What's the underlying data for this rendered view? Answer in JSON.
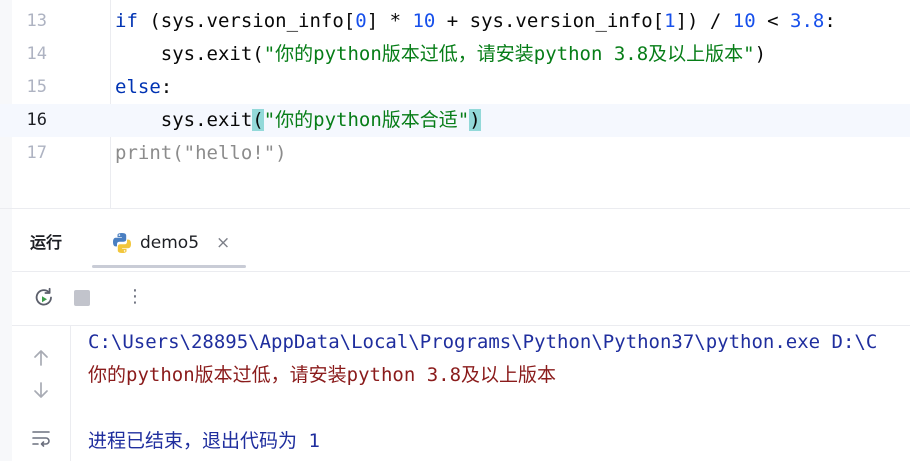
{
  "editor": {
    "lines": [
      {
        "number": "13",
        "tokens": [
          {
            "t": "if",
            "c": "kw"
          },
          {
            "t": " (sys.version_info[",
            "c": ""
          },
          {
            "t": "0",
            "c": "num"
          },
          {
            "t": "] * ",
            "c": ""
          },
          {
            "t": "10",
            "c": "num"
          },
          {
            "t": " + sys.version_info[",
            "c": ""
          },
          {
            "t": "1",
            "c": "num"
          },
          {
            "t": "]) / ",
            "c": ""
          },
          {
            "t": "10",
            "c": "num"
          },
          {
            "t": " < ",
            "c": ""
          },
          {
            "t": "3.8",
            "c": "num"
          },
          {
            "t": ":",
            "c": ""
          }
        ]
      },
      {
        "number": "14",
        "tokens": [
          {
            "t": "    sys.exit(",
            "c": ""
          },
          {
            "t": "\"你的python版本过低，请安装python 3.8及以上版本\"",
            "c": "str"
          },
          {
            "t": ")",
            "c": ""
          }
        ]
      },
      {
        "number": "15",
        "tokens": [
          {
            "t": "else",
            "c": "kw"
          },
          {
            "t": ":",
            "c": ""
          }
        ]
      },
      {
        "number": "16",
        "current": true,
        "tokens": [
          {
            "t": "    sys.exit",
            "c": ""
          },
          {
            "t": "(",
            "c": "brace"
          },
          {
            "t": "\"你的python版本合适\"",
            "c": "str"
          },
          {
            "t": ")",
            "c": "brace"
          }
        ]
      },
      {
        "number": "17",
        "tokens": [
          {
            "t": "print(\"hello!\")",
            "c": "unused"
          }
        ]
      }
    ]
  },
  "run_panel": {
    "title": "运行",
    "tab": {
      "label": "demo5",
      "close": "×",
      "icon": "python-icon"
    },
    "toolbar": {
      "rerun_icon": "rerun-icon",
      "stop_icon": "stop-icon",
      "more": "⋮"
    },
    "rail": [
      "arrow-up-icon",
      "arrow-down-icon",
      "soft-wrap-icon"
    ],
    "console": {
      "command": "C:\\Users\\28895\\AppData\\Local\\Programs\\Python\\Python37\\python.exe D:\\C",
      "error": "你的python版本过低，请安装python 3.8及以上版本",
      "blank": "",
      "exit": "进程已结束，退出代码为 1"
    }
  },
  "colors": {
    "keyword": "#0033b3",
    "number": "#1750eb",
    "string": "#067d17",
    "brace_match": "#93d9d9",
    "current_line": "#f5f8fe",
    "stderr": "#8a1b1b",
    "console_text": "#1f2e9e"
  }
}
